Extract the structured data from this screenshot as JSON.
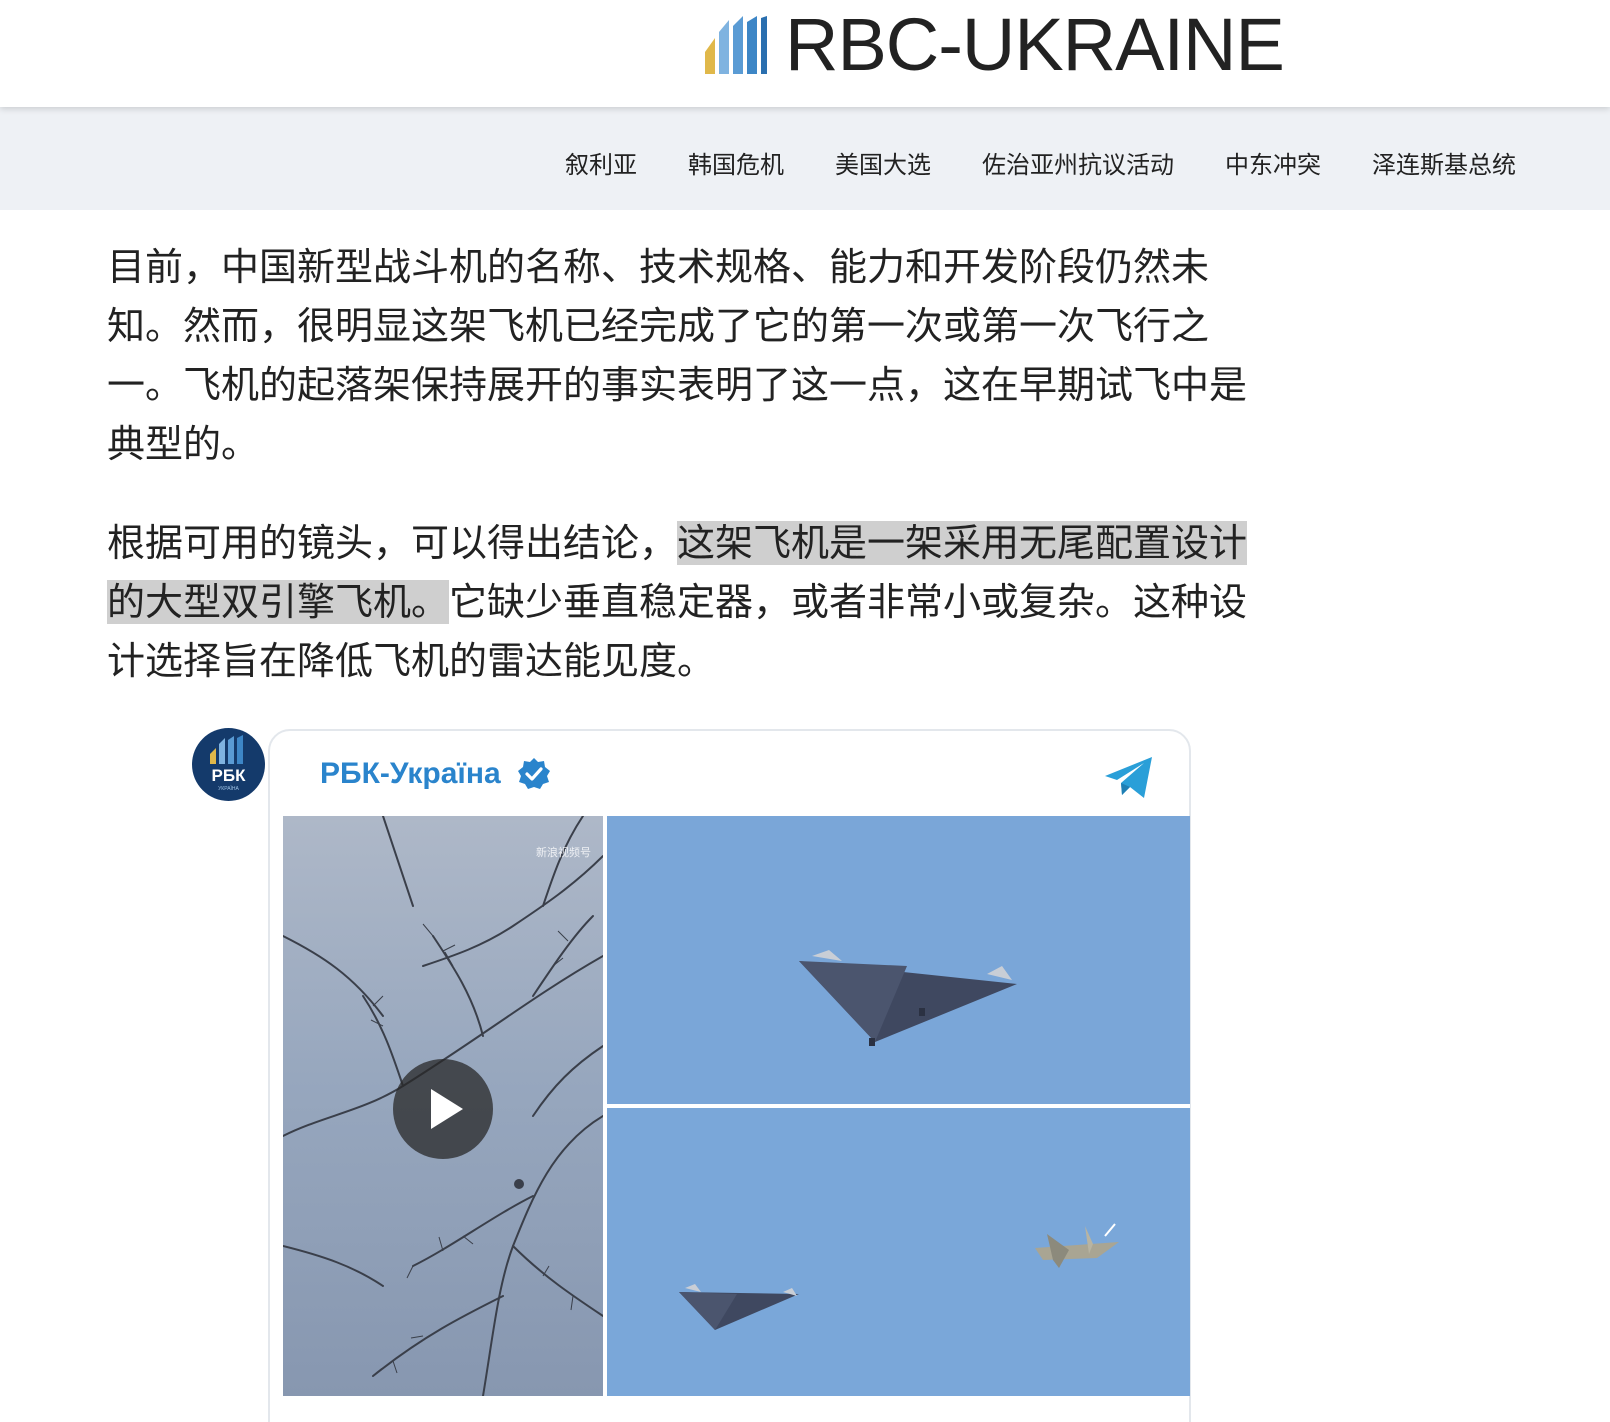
{
  "header": {
    "logo_text": "RBC-UKRAINE"
  },
  "nav": {
    "items": [
      {
        "label": "叙利亚"
      },
      {
        "label": "韩国危机"
      },
      {
        "label": "美国大选"
      },
      {
        "label": "佐治亚州抗议活动"
      },
      {
        "label": "中东冲突"
      },
      {
        "label": "泽连斯基总统"
      }
    ]
  },
  "article": {
    "para1": "目前，中国新型战斗机的名称、技术规格、能力和开发阶段仍然未知。然而，很明显这架飞机已经完成了它的第一次或第一次飞行之一。飞机的起落架保持展开的事实表明了这一点，这在早期试飞中是典型的。",
    "para2_before": "根据可用的镜头，可以得出结论，",
    "para2_highlight": "这架飞机是一架采用无尾配置设计的大型双引擎飞机。",
    "para2_after": "它缺少垂直稳定器，或者非常小或复杂。这种设计选择旨在降低飞机的雷达能见度。"
  },
  "embed": {
    "channel_name": "РБК-Україна",
    "avatar_text": "РБК",
    "avatar_subtext": "УКРАЇНА",
    "watermark": "新浪视频号",
    "colors": {
      "channel": "#2a84cc",
      "verified": "#2a84cc",
      "telegram": "#2a9fd8",
      "avatar_bg": "#143a6b"
    },
    "icons": [
      "verified-badge-icon",
      "telegram-icon",
      "play-icon"
    ]
  }
}
